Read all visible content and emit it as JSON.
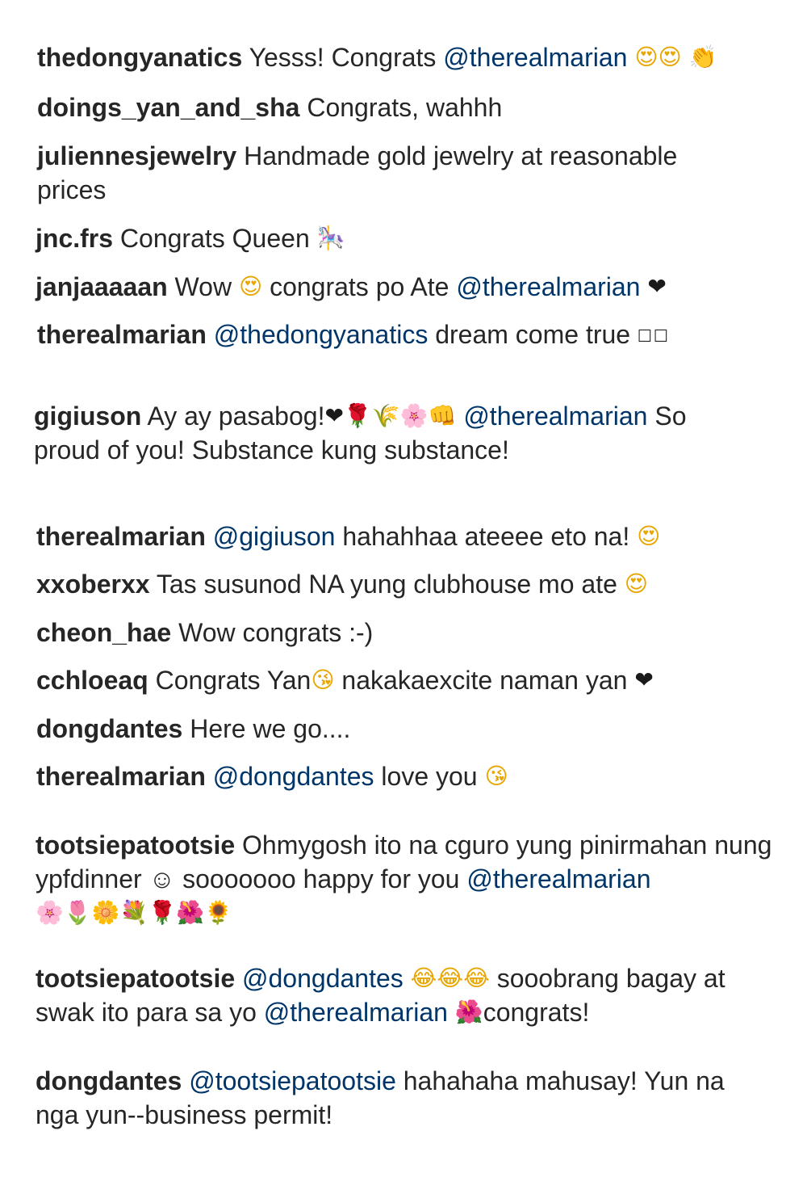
{
  "comments": [
    {
      "user": "thedongyanatics",
      "parts": [
        {
          "t": "text",
          "v": "Yesss! Congrats "
        },
        {
          "t": "mention",
          "v": "@therealmarian"
        },
        {
          "t": "text",
          "v": " "
        },
        {
          "t": "emoji",
          "name": "heart-eyes-icon",
          "v": "😍😍",
          "cls": "face"
        },
        {
          "t": "text",
          "v": " "
        },
        {
          "t": "emoji",
          "name": "clapping-hands-icon",
          "v": "👏",
          "cls": "clap"
        }
      ]
    },
    {
      "user": "doings_yan_and_sha",
      "parts": [
        {
          "t": "text",
          "v": "Congrats, wahhh"
        }
      ]
    },
    {
      "user": "juliennesjewelry",
      "parts": [
        {
          "t": "text",
          "v": "Handmade gold jewelry at reasonable prices"
        }
      ]
    },
    {
      "user": "jnc.frs",
      "parts": [
        {
          "t": "text",
          "v": "Congrats Queen "
        },
        {
          "t": "emoji",
          "name": "carousel-icon",
          "v": "🎠",
          "cls": "rose"
        }
      ]
    },
    {
      "user": "janjaaaaan",
      "parts": [
        {
          "t": "text",
          "v": "Wow "
        },
        {
          "t": "emoji",
          "name": "heart-eyes-icon",
          "v": "😍",
          "cls": "face"
        },
        {
          "t": "text",
          "v": " congrats po Ate "
        },
        {
          "t": "mention",
          "v": "@therealmarian"
        },
        {
          "t": "text",
          "v": " "
        },
        {
          "t": "emoji",
          "name": "heart-icon",
          "v": "❤",
          "cls": "heart"
        }
      ]
    },
    {
      "user": "therealmarian",
      "parts": [
        {
          "t": "mention",
          "v": "@thedongyanatics"
        },
        {
          "t": "text",
          "v": " dream come true "
        },
        {
          "t": "emoji",
          "name": "missing-glyph-icon",
          "v": "☐☐",
          "cls": "tofu"
        }
      ]
    },
    {
      "user": "gigiuson",
      "parts": [
        {
          "t": "text",
          "v": "Ay ay pasabog!"
        },
        {
          "t": "emoji",
          "name": "heart-icon",
          "v": "❤",
          "cls": "heart"
        },
        {
          "t": "emoji",
          "name": "rose-icon",
          "v": "🌹",
          "cls": "rose"
        },
        {
          "t": "emoji",
          "name": "rice-plant-icon",
          "v": "🌾",
          "cls": "grass"
        },
        {
          "t": "emoji",
          "name": "cherry-blossom-icon",
          "v": "🌸",
          "cls": "flower"
        },
        {
          "t": "emoji",
          "name": "fist-bump-icon",
          "v": "👊",
          "cls": "fist"
        },
        {
          "t": "text",
          "v": " "
        },
        {
          "t": "mention",
          "v": "@therealmarian"
        },
        {
          "t": "text",
          "v": " So proud of you! Substance kung substance!"
        }
      ]
    },
    {
      "user": "therealmarian",
      "parts": [
        {
          "t": "mention",
          "v": "@gigiuson"
        },
        {
          "t": "text",
          "v": " hahahhaa ateeee eto na! "
        },
        {
          "t": "emoji",
          "name": "heart-eyes-icon",
          "v": "😍",
          "cls": "face"
        }
      ]
    },
    {
      "user": "xxoberxx",
      "parts": [
        {
          "t": "text",
          "v": "Tas susunod NA yung clubhouse mo ate "
        },
        {
          "t": "emoji",
          "name": "heart-eyes-icon",
          "v": "😍",
          "cls": "face"
        }
      ]
    },
    {
      "user": "cheon_hae",
      "parts": [
        {
          "t": "text",
          "v": "Wow congrats :-)"
        }
      ]
    },
    {
      "user": "cchloeaq",
      "parts": [
        {
          "t": "text",
          "v": "Congrats Yan"
        },
        {
          "t": "emoji",
          "name": "blowing-kiss-icon",
          "v": "😘",
          "cls": "face"
        },
        {
          "t": "text",
          "v": " nakakaexcite naman yan "
        },
        {
          "t": "emoji",
          "name": "heart-icon",
          "v": "❤",
          "cls": "heart"
        }
      ]
    },
    {
      "user": "dongdantes",
      "parts": [
        {
          "t": "text",
          "v": "Here we go...."
        }
      ]
    },
    {
      "user": "therealmarian",
      "parts": [
        {
          "t": "mention",
          "v": "@dongdantes"
        },
        {
          "t": "text",
          "v": " love you "
        },
        {
          "t": "emoji",
          "name": "blowing-kiss-icon",
          "v": "😘",
          "cls": "face"
        }
      ]
    },
    {
      "user": "tootsiepatootsie",
      "parts": [
        {
          "t": "text",
          "v": "Ohmygosh ito na cguro yung pinirmahan nung ypfdinner ☺ sooooooo happy for you "
        },
        {
          "t": "mention",
          "v": "@therealmarian"
        },
        {
          "t": "text",
          "v": " "
        },
        {
          "t": "emoji",
          "name": "flowers-icon",
          "v": "🌸🌷🌼💐🌹🌺🌻",
          "cls": "flower"
        }
      ]
    },
    {
      "user": "tootsiepatootsie",
      "parts": [
        {
          "t": "mention",
          "v": "@dongdantes"
        },
        {
          "t": "text",
          "v": " "
        },
        {
          "t": "emoji",
          "name": "tears-of-joy-icon",
          "v": "😂😂😂",
          "cls": "face"
        },
        {
          "t": "text",
          "v": " sooobrang bagay at swak ito para sa yo "
        },
        {
          "t": "mention",
          "v": "@therealmarian"
        },
        {
          "t": "text",
          "v": " "
        },
        {
          "t": "emoji",
          "name": "hibiscus-icon",
          "v": "🌺",
          "cls": "rose"
        },
        {
          "t": "text",
          "v": "congrats!"
        }
      ]
    },
    {
      "user": "dongdantes",
      "parts": [
        {
          "t": "mention",
          "v": "@tootsiepatootsie"
        },
        {
          "t": "text",
          "v": " hahahaha mahusay! Yun na nga yun--business permit!"
        }
      ]
    }
  ]
}
